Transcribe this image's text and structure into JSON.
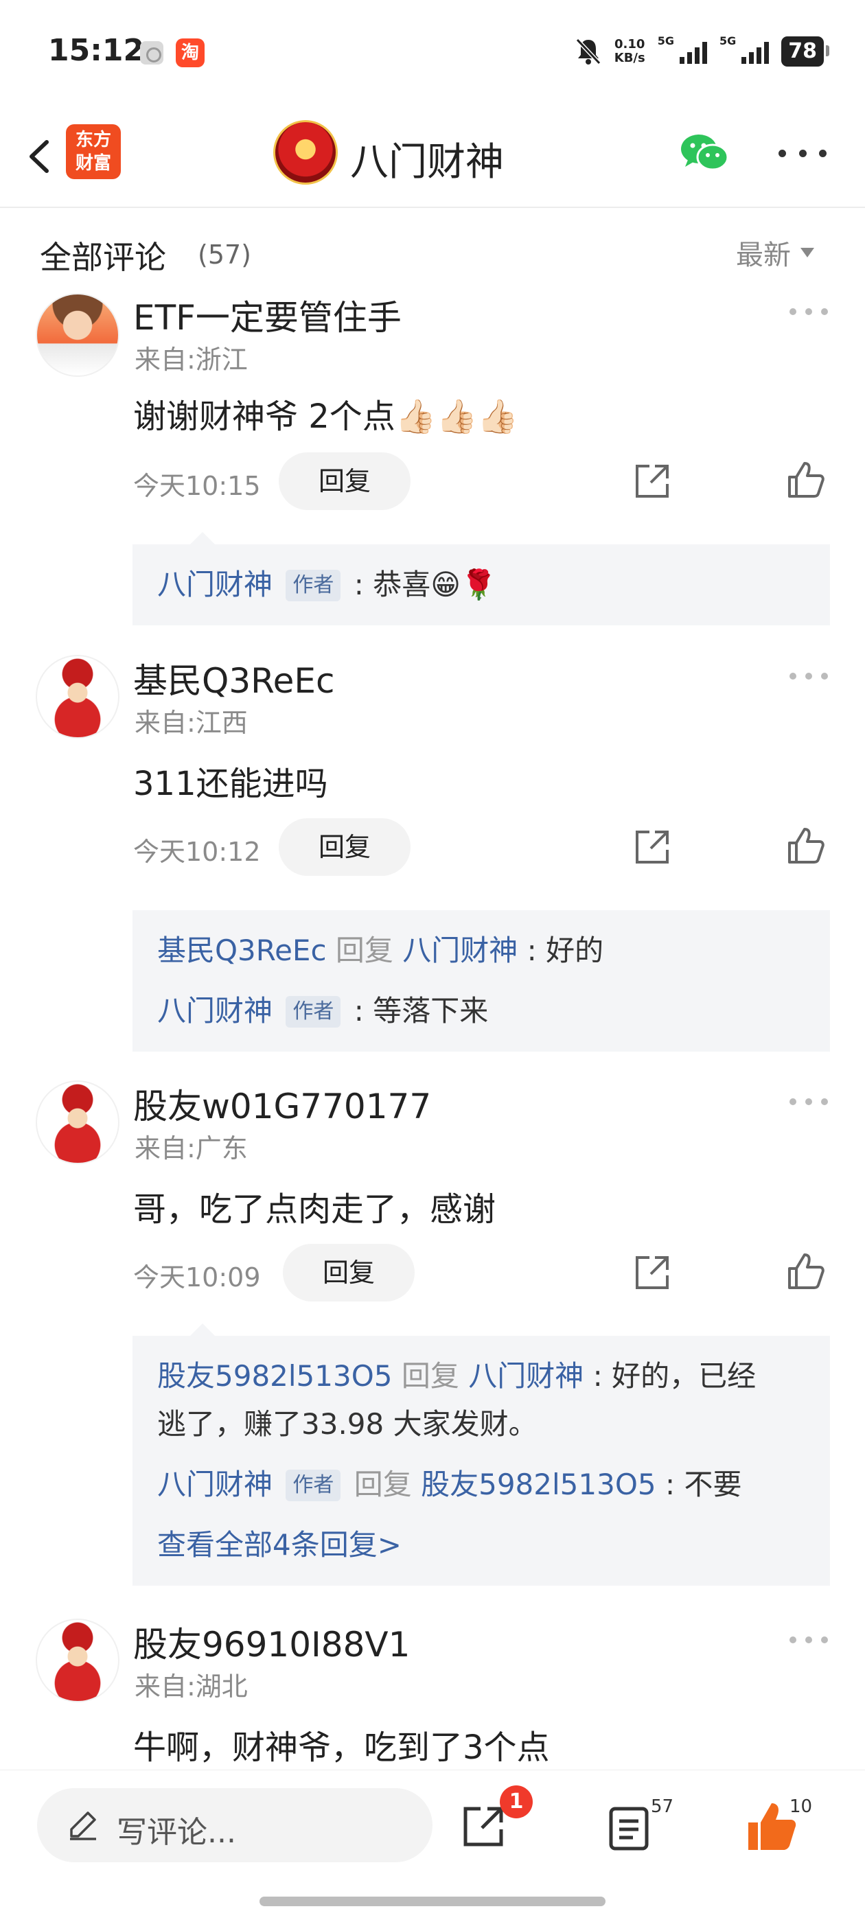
{
  "status_bar": {
    "time": "15:12",
    "app2_glyph": "淘",
    "net_speed_value": "0.10",
    "net_speed_unit": "KB/s",
    "sig1_label": "5G",
    "sig2_label": "5G",
    "battery": "78"
  },
  "nav": {
    "logo_line1": "东方",
    "logo_line2": "财富",
    "title": "八门财神",
    "icons": [
      "back-icon",
      "wechat-icon",
      "more-icon"
    ]
  },
  "comments_header": {
    "title": "全部评论",
    "count": "(57)",
    "sort_label": "最新"
  },
  "comments": [
    {
      "user": "ETF一定要管住手",
      "from": "来自:浙江",
      "text": "谢谢财神爷  2个点👍🏻👍🏻👍🏻",
      "time": "今天10:15",
      "reply_label": "回复",
      "replies": [
        {
          "name": "八门财神",
          "author_tag": "作者",
          "text": "恭喜😁🌹"
        }
      ]
    },
    {
      "user": "基民Q3ReEc",
      "from": "来自:江西",
      "text": "311还能进吗",
      "time": "今天10:12",
      "reply_label": "回复",
      "replies": [
        {
          "name": "基民Q3ReEc",
          "reply_word": "回复",
          "to": "八门财神",
          "text": "好的"
        },
        {
          "name": "八门财神",
          "author_tag": "作者",
          "text": "等落下来"
        }
      ]
    },
    {
      "user": "股友w01G770177",
      "from": "来自:广东",
      "text": "哥，吃了点肉走了，感谢",
      "time": "今天10:09",
      "reply_label": "回复",
      "replies": [
        {
          "name": "股友5982l513O5",
          "reply_word": "回复",
          "to": "八门财神",
          "text_line1": "好的，已经",
          "text_line2": "逃了，赚了33.98 大家发财。"
        },
        {
          "name": "八门财神",
          "author_tag": "作者",
          "reply_word": "回复",
          "to": "股友5982l513O5",
          "text": "不要"
        }
      ],
      "view_all": "查看全部4条回复>"
    },
    {
      "user": "股友96910I88V1",
      "from": "来自:湖北",
      "text": "牛啊，财神爷，吃到了3个点"
    }
  ],
  "bottom_bar": {
    "write_placeholder": "写评论...",
    "share_badge": "1",
    "comment_count": "57",
    "like_count": "10",
    "like_color": "#f26a1b"
  }
}
